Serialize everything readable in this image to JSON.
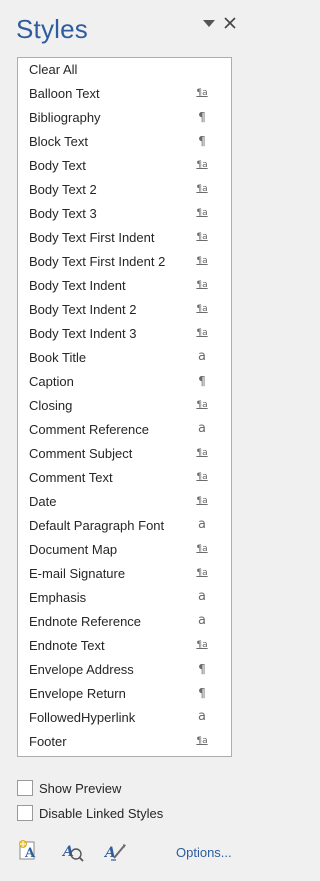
{
  "pane": {
    "title": "Styles"
  },
  "styles": [
    {
      "name": "Clear All",
      "glyph": ""
    },
    {
      "name": "Balloon Text",
      "glyph": "¶a"
    },
    {
      "name": "Bibliography",
      "glyph": "¶"
    },
    {
      "name": "Block Text",
      "glyph": "¶"
    },
    {
      "name": "Body Text",
      "glyph": "¶a"
    },
    {
      "name": "Body Text 2",
      "glyph": "¶a"
    },
    {
      "name": "Body Text 3",
      "glyph": "¶a"
    },
    {
      "name": "Body Text First Indent",
      "glyph": "¶a"
    },
    {
      "name": "Body Text First Indent 2",
      "glyph": "¶a"
    },
    {
      "name": "Body Text Indent",
      "glyph": "¶a"
    },
    {
      "name": "Body Text Indent 2",
      "glyph": "¶a"
    },
    {
      "name": "Body Text Indent 3",
      "glyph": "¶a"
    },
    {
      "name": "Book Title",
      "glyph": "a"
    },
    {
      "name": "Caption",
      "glyph": "¶"
    },
    {
      "name": "Closing",
      "glyph": "¶a"
    },
    {
      "name": "Comment Reference",
      "glyph": "a"
    },
    {
      "name": "Comment Subject",
      "glyph": "¶a"
    },
    {
      "name": "Comment Text",
      "glyph": "¶a"
    },
    {
      "name": "Date",
      "glyph": "¶a"
    },
    {
      "name": "Default Paragraph Font",
      "glyph": "a"
    },
    {
      "name": "Document Map",
      "glyph": "¶a"
    },
    {
      "name": "E-mail Signature",
      "glyph": "¶a"
    },
    {
      "name": "Emphasis",
      "glyph": "a"
    },
    {
      "name": "Endnote Reference",
      "glyph": "a"
    },
    {
      "name": "Endnote Text",
      "glyph": "¶a"
    },
    {
      "name": "Envelope Address",
      "glyph": "¶"
    },
    {
      "name": "Envelope Return",
      "glyph": "¶"
    },
    {
      "name": "FollowedHyperlink",
      "glyph": "a"
    },
    {
      "name": "Footer",
      "glyph": "¶a"
    }
  ],
  "options": {
    "show_preview": {
      "label": "Show Preview",
      "checked": false
    },
    "disable_linked": {
      "label": "Disable Linked Styles",
      "checked": false
    }
  },
  "footer": {
    "options_link": "Options..."
  },
  "icons": {
    "menu": "dropdown-arrow-icon",
    "close": "close-icon",
    "new_style": "new-style-icon",
    "style_inspector": "style-inspector-icon",
    "manage_styles": "manage-styles-icon"
  },
  "colors": {
    "title": "#2e5c9e",
    "link": "#2e5c9e",
    "pane_background": "#f0f0f0"
  }
}
